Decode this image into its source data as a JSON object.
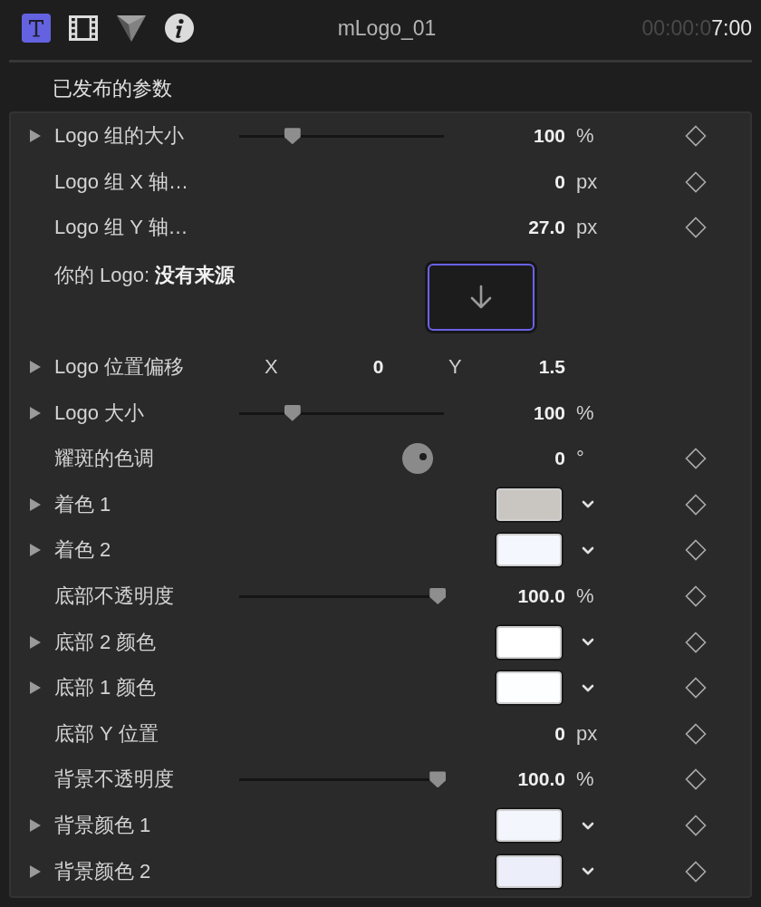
{
  "toolbar": {
    "tabs": [
      {
        "kind": "text",
        "selected": true
      },
      {
        "kind": "film",
        "selected": false
      },
      {
        "kind": "shape",
        "selected": false
      },
      {
        "kind": "info",
        "selected": false
      }
    ],
    "title": "mLogo_01",
    "timecode_dim": "00:00:0",
    "timecode_bright": "7:00"
  },
  "section_title": "已发布的参数",
  "rows": [
    {
      "kind": "slider",
      "label": "Logo 组的大小",
      "disclosure": true,
      "level": 0.26,
      "value": "100",
      "unit": "%",
      "keyframe": true
    },
    {
      "kind": "value",
      "label": "Logo 组 X 轴…",
      "disclosure": false,
      "value": "0",
      "unit": "px",
      "keyframe": true
    },
    {
      "kind": "value",
      "label": "Logo 组 Y 轴…",
      "disclosure": false,
      "value": "27.0",
      "unit": "px",
      "keyframe": true
    },
    {
      "kind": "source",
      "label": "你的 Logo: **没有来源**",
      "disclosure": false,
      "keyframe": false
    },
    {
      "kind": "offset",
      "label": "Logo 位置偏移",
      "disclosure": true,
      "x_label": "X",
      "x_value": "0",
      "y_label": "Y",
      "y_value": "1.5",
      "keyframe": false
    },
    {
      "kind": "slider",
      "label": "Logo 大小",
      "disclosure": true,
      "level": 0.26,
      "value": "100",
      "unit": "%",
      "keyframe": false
    },
    {
      "kind": "hue",
      "label": "耀斑的色调",
      "disclosure": false,
      "value": "0",
      "unit": "°",
      "keyframe": true
    },
    {
      "kind": "color",
      "label": "着色 1",
      "disclosure": true,
      "color": "#c9c5c1",
      "keyframe": true
    },
    {
      "kind": "color",
      "label": "着色 2",
      "disclosure": true,
      "color": "#f4f7fd",
      "keyframe": true
    },
    {
      "kind": "slider",
      "label": "底部不透明度",
      "disclosure": false,
      "level": 0.97,
      "value": "100.0",
      "unit": "%",
      "keyframe": true
    },
    {
      "kind": "color",
      "label": "底部 2 颜色",
      "disclosure": true,
      "color": "#ffffff",
      "keyframe": true
    },
    {
      "kind": "color",
      "label": "底部 1 颜色",
      "disclosure": true,
      "color": "#fdfeff",
      "keyframe": true
    },
    {
      "kind": "value",
      "label": "底部 Y 位置",
      "disclosure": false,
      "value": "0",
      "unit": "px",
      "keyframe": true
    },
    {
      "kind": "slider",
      "label": "背景不透明度",
      "disclosure": false,
      "level": 0.97,
      "value": "100.0",
      "unit": "%",
      "keyframe": true
    },
    {
      "kind": "color",
      "label": "背景颜色 1",
      "disclosure": true,
      "color": "#f3f6fc",
      "keyframe": true
    },
    {
      "kind": "color",
      "label": "背景颜色 2",
      "disclosure": true,
      "color": "#eceffa",
      "keyframe": true
    }
  ]
}
